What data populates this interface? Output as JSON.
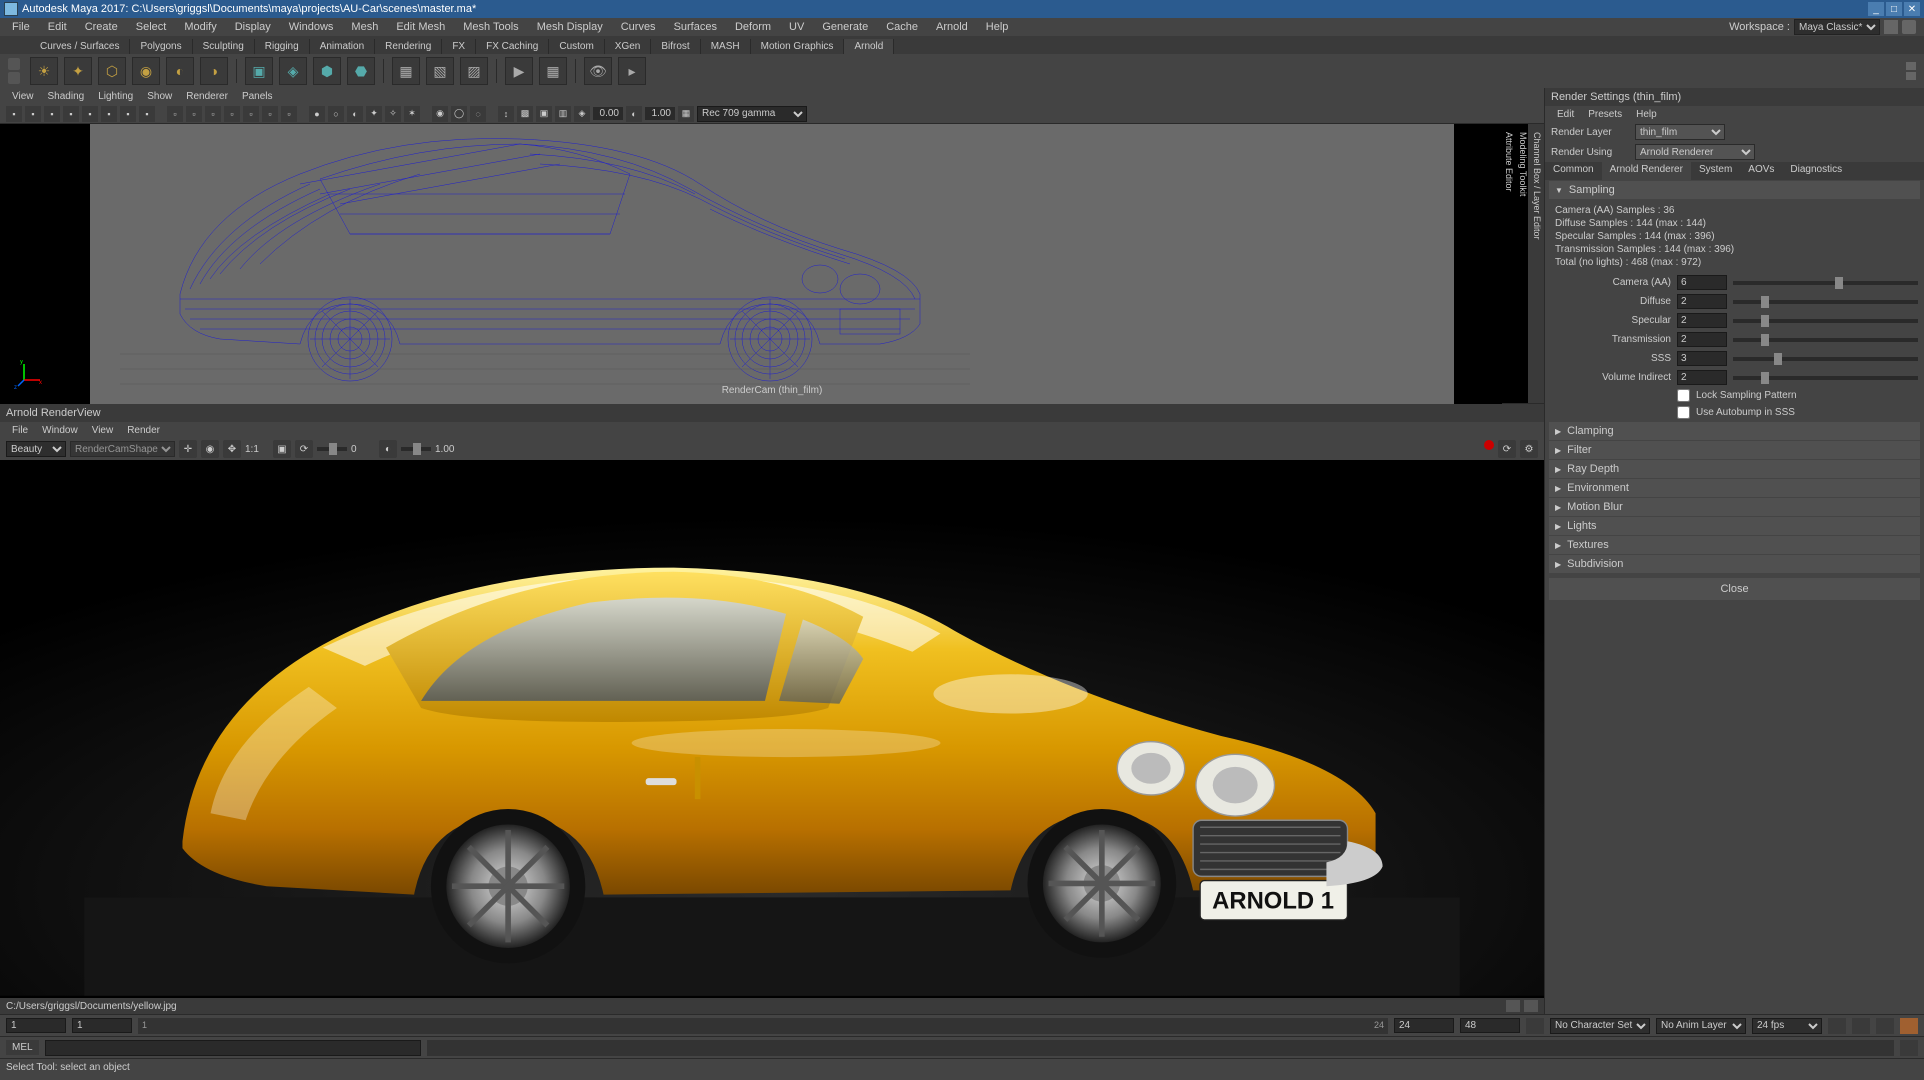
{
  "title": "Autodesk Maya 2017: C:\\Users\\griggsl\\Documents\\maya\\projects\\AU-Car\\scenes\\master.ma*",
  "menus": [
    "File",
    "Edit",
    "Create",
    "Select",
    "Modify",
    "Display",
    "Windows",
    "Mesh",
    "Edit Mesh",
    "Mesh Tools",
    "Mesh Display",
    "Curves",
    "Surfaces",
    "Deform",
    "UV",
    "Generate",
    "Cache",
    "Arnold",
    "Help"
  ],
  "workspace": {
    "label": "Workspace :",
    "value": "Maya Classic*"
  },
  "shelfTabs": [
    "Curves / Surfaces",
    "Polygons",
    "Sculpting",
    "Rigging",
    "Animation",
    "Rendering",
    "FX",
    "FX Caching",
    "Custom",
    "XGen",
    "Bifrost",
    "MASH",
    "Motion Graphics",
    "Arnold"
  ],
  "shelfActive": "Arnold",
  "viewportMenus": [
    "View",
    "Shading",
    "Lighting",
    "Show",
    "Renderer",
    "Panels"
  ],
  "viewportToolbar": {
    "expA": "0.00",
    "expB": "1.00",
    "gamma": "Rec 709 gamma"
  },
  "camLabel": "RenderCam (thin_film)",
  "vertTabs": [
    "Channel Box / Layer Editor",
    "Modeling Toolkit",
    "Attribute Editor"
  ],
  "arnoldTitle": "Arnold RenderView",
  "arnoldMenus": [
    "File",
    "Window",
    "View",
    "Render"
  ],
  "arnoldToolbar": {
    "mode": "Beauty",
    "camera": "RenderCamShape",
    "scaleA": "0",
    "scaleB": "1.00",
    "ratio": "1:1"
  },
  "renderPath": "C:/Users/griggsl/Documents/yellow.jpg",
  "plate": "ARNOLD 1",
  "rightPanel": {
    "title": "Render Settings (thin_film)",
    "menus": [
      "Edit",
      "Presets",
      "Help"
    ],
    "renderLayer": {
      "label": "Render Layer",
      "value": "thin_film"
    },
    "renderUsing": {
      "label": "Render Using",
      "value": "Arnold Renderer"
    },
    "tabs": [
      "Common",
      "Arnold Renderer",
      "System",
      "AOVs",
      "Diagnostics"
    ],
    "activeTab": "Arnold Renderer",
    "sampling": {
      "header": "Sampling",
      "stats": [
        "Camera (AA) Samples : 36",
        "Diffuse Samples : 144 (max : 144)",
        "Specular Samples : 144 (max : 396)",
        "Transmission Samples : 144 (max : 396)",
        "Total (no lights) : 468 (max : 972)"
      ],
      "params": [
        {
          "label": "Camera (AA)",
          "value": "6",
          "pos": 55
        },
        {
          "label": "Diffuse",
          "value": "2",
          "pos": 15
        },
        {
          "label": "Specular",
          "value": "2",
          "pos": 15
        },
        {
          "label": "Transmission",
          "value": "2",
          "pos": 15
        },
        {
          "label": "SSS",
          "value": "3",
          "pos": 22
        },
        {
          "label": "Volume Indirect",
          "value": "2",
          "pos": 15
        }
      ],
      "checks": [
        {
          "label": "Lock Sampling Pattern",
          "checked": false
        },
        {
          "label": "Use Autobump in SSS",
          "checked": false
        }
      ]
    },
    "collapsed": [
      "Clamping",
      "Filter",
      "Ray Depth",
      "Environment",
      "Motion Blur",
      "Lights",
      "Textures",
      "Subdivision"
    ],
    "close": "Close"
  },
  "timeline": {
    "startRange": "1",
    "start": "1",
    "trackStart": "1",
    "trackEnd": "24",
    "end": "24",
    "endRange": "48",
    "charSet": "No Character Set",
    "animLayer": "No Anim Layer",
    "fps": "24 fps"
  },
  "mel": "MEL",
  "status": "Select Tool: select an object"
}
